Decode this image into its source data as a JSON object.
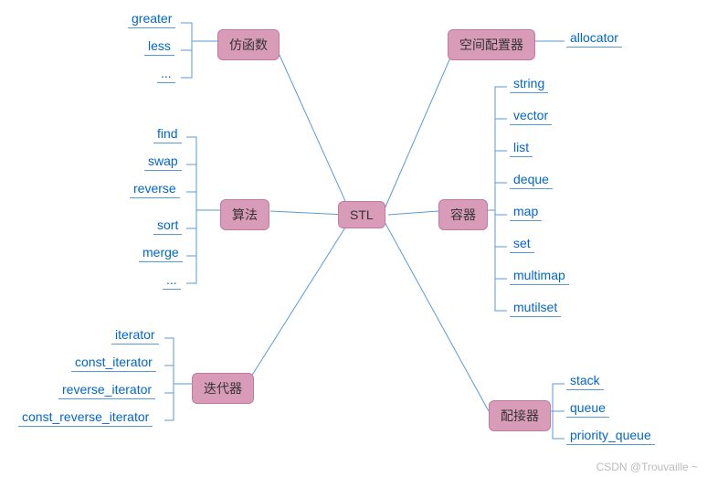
{
  "root": {
    "label": "STL"
  },
  "branches": {
    "functor": {
      "label": "仿函数",
      "items": [
        "greater",
        "less",
        "..."
      ]
    },
    "algorithm": {
      "label": "算法",
      "items": [
        "find",
        "swap",
        "reverse",
        "sort",
        "merge",
        "..."
      ]
    },
    "iterator": {
      "label": "迭代器",
      "items": [
        "iterator",
        "const_iterator",
        "reverse_iterator",
        "const_reverse_iterator"
      ]
    },
    "allocator": {
      "label": "空间配置器",
      "items": [
        "allocator"
      ]
    },
    "container": {
      "label": "容器",
      "items": [
        "string",
        "vector",
        "list",
        "deque",
        "map",
        "set",
        "multimap",
        "mutilset"
      ]
    },
    "adapter": {
      "label": "配接器",
      "items": [
        "stack",
        "queue",
        "priority_queue"
      ]
    }
  },
  "watermark": "CSDN @Trouvaille ~"
}
